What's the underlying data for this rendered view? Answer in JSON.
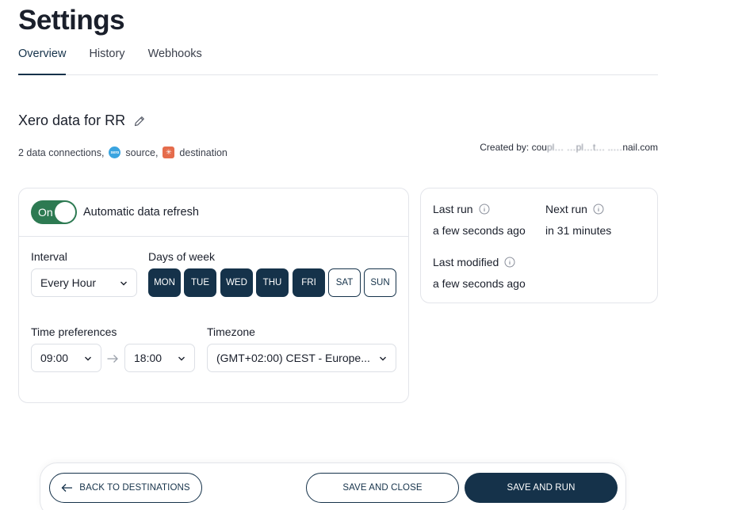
{
  "page": {
    "title": "Settings"
  },
  "tabs": [
    {
      "label": "Overview",
      "active": true
    },
    {
      "label": "History",
      "active": false
    },
    {
      "label": "Webhooks",
      "active": false
    }
  ],
  "flow": {
    "name": "Xero data for RR",
    "connections_text": "2 data connections,",
    "source_label": "source,",
    "destination_label": "destination",
    "created_by_label": "Created by: cou",
    "created_by_masked": "pl… …pl…t… ..…",
    "created_by_suffix": "nail.com"
  },
  "refresh": {
    "toggle_label": "On",
    "title": "Automatic data refresh",
    "interval_label": "Interval",
    "interval_value": "Every Hour",
    "days_label": "Days of week",
    "days": [
      {
        "label": "MON",
        "on": true
      },
      {
        "label": "TUE",
        "on": true
      },
      {
        "label": "WED",
        "on": true
      },
      {
        "label": "THU",
        "on": true
      },
      {
        "label": "FRI",
        "on": true
      },
      {
        "label": "SAT",
        "on": false
      },
      {
        "label": "SUN",
        "on": false
      }
    ],
    "time_label": "Time preferences",
    "time_from": "09:00",
    "time_to": "18:00",
    "timezone_label": "Timezone",
    "timezone_value": "(GMT+02:00) CEST - Europe..."
  },
  "status": {
    "last_run_label": "Last run",
    "last_run_value": "a few seconds ago",
    "next_run_label": "Next run",
    "next_run_value": "in 31 minutes",
    "last_modified_label": "Last modified",
    "last_modified_value": "a few seconds ago"
  },
  "actions": {
    "back_label": "BACK TO DESTINATIONS",
    "save_close_label": "SAVE AND CLOSE",
    "save_run_label": "SAVE AND RUN"
  },
  "colors": {
    "primary": "#15324a",
    "toggle_on": "#2d7a52",
    "source_icon": "#3aa4e0",
    "destination_icon": "#e56c4c"
  }
}
